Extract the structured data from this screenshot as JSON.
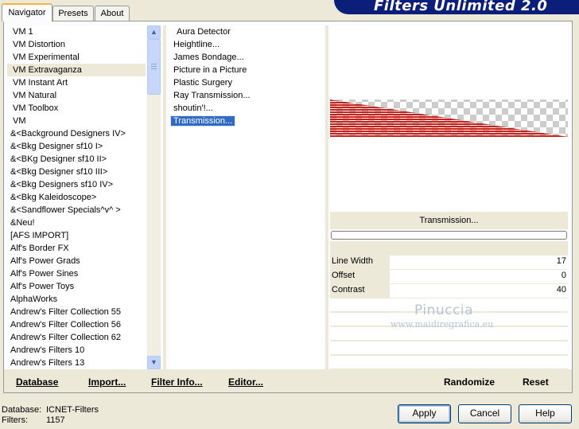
{
  "tabs": [
    "Navigator",
    "Presets",
    "About"
  ],
  "brand": "Filters Unlimited 2.0",
  "categories": [
    "VM 1",
    "VM Distortion",
    "VM Experimental",
    "VM Extravaganza",
    "VM Instant Art",
    "VM Natural",
    "VM Toolbox",
    "VM",
    "&<Background Designers IV>",
    "&<Bkg Designer sf10 I>",
    "&<BKg Designer sf10 II>",
    "&<Bkg Designer sf10 III>",
    "&<Bkg Designers sf10 IV>",
    "&<Bkg Kaleidoscope>",
    "&<Sandflower Specials^v^ >",
    "&Neu!",
    "[AFS IMPORT]",
    "Alf's Border FX",
    "Alf's Power Grads",
    "Alf's Power Sines",
    "Alf's Power Toys",
    "AlphaWorks",
    "Andrew's Filter Collection 55",
    "Andrew's Filter Collection 56",
    "Andrew's Filter Collection 62",
    "Andrew's Filters 10",
    "Andrew's Filters 13"
  ],
  "filters": [
    "Aura Detector",
    "Heightline...",
    "James Bondage...",
    "Picture in a Picture",
    "Plastic Surgery",
    "Ray Transmission...",
    "shoutin'!...",
    "Transmission..."
  ],
  "selected_filter_name": "Transmission...",
  "progress": 0,
  "params": [
    {
      "label": "Line Width",
      "value": "17"
    },
    {
      "label": "Offset",
      "value": "0"
    },
    {
      "label": "Contrast",
      "value": "40"
    }
  ],
  "watermark": {
    "name": "Pinuccia",
    "url": "www.maidiregrafica.eu"
  },
  "bottom_links": {
    "database": "Database",
    "import": "Import...",
    "filter_info": "Filter Info...",
    "editor": "Editor...",
    "randomize": "Randomize",
    "reset": "Reset"
  },
  "status": {
    "database_label": "Database:",
    "database_value": "ICNET-Filters",
    "filters_label": "Filters:",
    "filters_value": "1157"
  },
  "buttons": {
    "apply": "Apply",
    "cancel": "Cancel",
    "help": "Help"
  },
  "colors": {
    "brand": "#0b1f7a",
    "selection": "#316ac5",
    "stripe": "#c8201a"
  },
  "icons": {
    "scroll_up": "▲",
    "scroll_down": "▼"
  }
}
